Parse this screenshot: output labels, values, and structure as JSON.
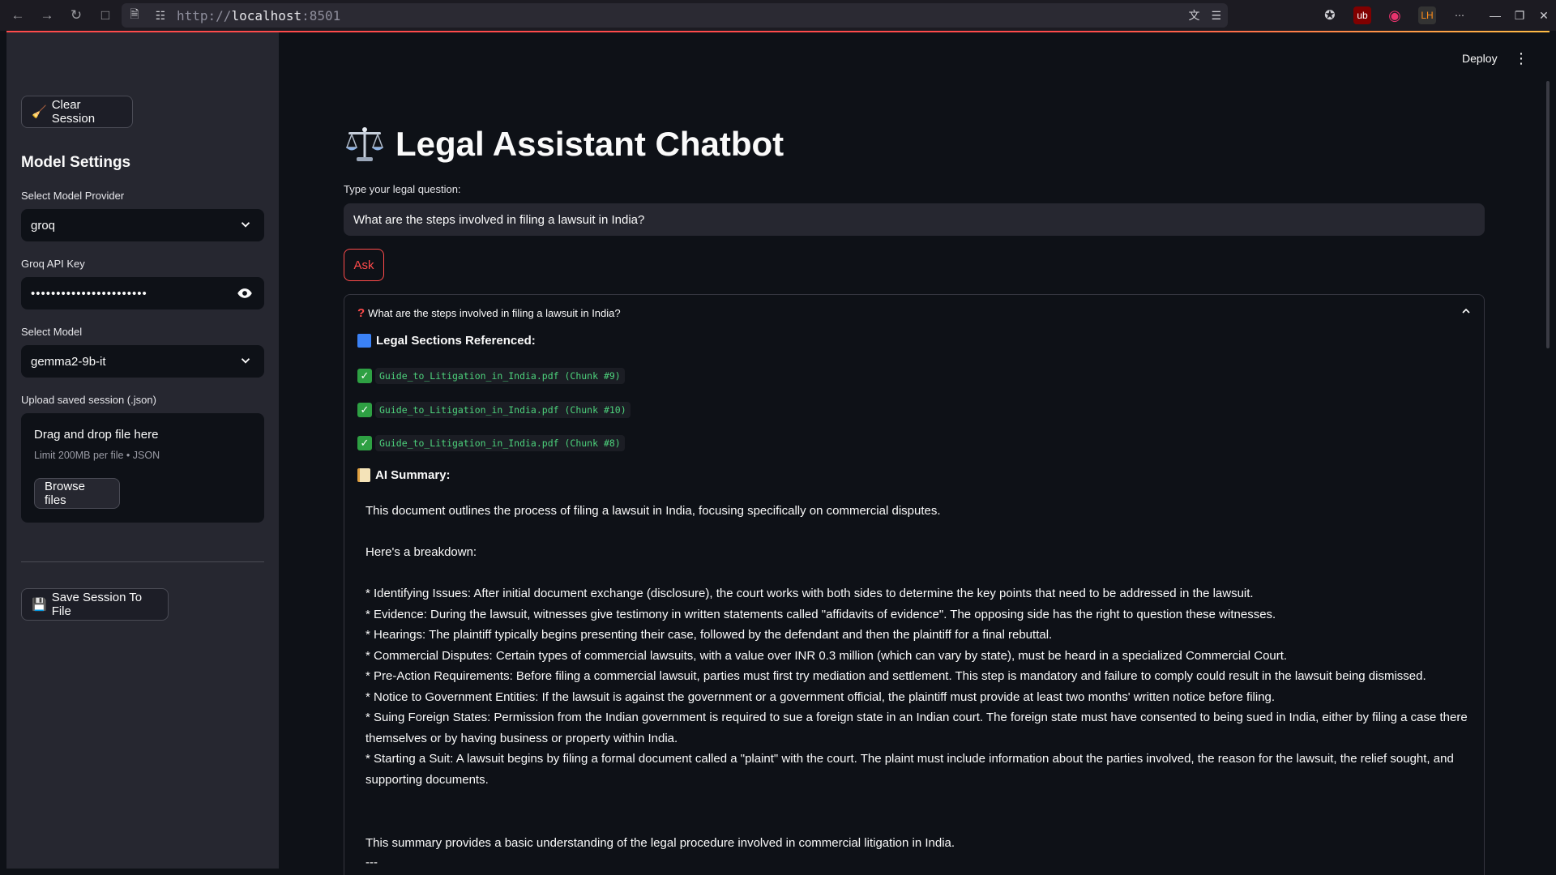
{
  "browser": {
    "url_prefix": "http://",
    "url_host": "localhost",
    "url_port": ":8501"
  },
  "sidebar": {
    "clear_session_label": "Clear Session",
    "heading": "Model Settings",
    "provider_label": "Select Model Provider",
    "provider_value": "groq",
    "api_key_label": "Groq API Key",
    "api_key_mask": "•••••••••••••••••••••••",
    "model_label": "Select Model",
    "model_value": "gemma2-9b-it",
    "upload_label": "Upload saved session (.json)",
    "dropzone_title": "Drag and drop file here",
    "dropzone_limit": "Limit 200MB per file • JSON",
    "browse_label": "Browse files",
    "save_session_label": "Save Session To File"
  },
  "header": {
    "deploy_label": "Deploy"
  },
  "main": {
    "title": "Legal Assistant Chatbot",
    "question_label": "Type your legal question:",
    "question_value": "What are the steps involved in filing a lawsuit in India?",
    "ask_label": "Ask",
    "expander_title": "What are the steps involved in filing a lawsuit in India?",
    "sections_heading": "Legal Sections Referenced:",
    "chunks": [
      "Guide_to_Litigation_in_India.pdf (Chunk #9)",
      "Guide_to_Litigation_in_India.pdf (Chunk #10)",
      "Guide_to_Litigation_in_India.pdf (Chunk #8)"
    ],
    "summary_heading": "AI Summary:",
    "summary_intro": "This document outlines the process of filing a lawsuit in India, focusing specifically on commercial disputes.",
    "summary_breakdown": "Here's a breakdown:",
    "summary_points": [
      "* Identifying Issues: After initial document exchange (disclosure), the court works with both sides to determine the key points that need to be addressed in the lawsuit.",
      "* Evidence: During the lawsuit, witnesses give testimony in written statements called \"affidavits of evidence\". The opposing side has the right to question these witnesses.",
      "* Hearings: The plaintiff typically begins presenting their case, followed by the defendant and then the plaintiff for a final rebuttal.",
      "* Commercial Disputes: Certain types of commercial lawsuits, with a value over INR 0.3 million (which can vary by state), must be heard in a specialized Commercial Court.",
      "* Pre-Action Requirements: Before filing a commercial lawsuit, parties must first try mediation and settlement. This step is mandatory and failure to comply could result in the lawsuit being dismissed.",
      "* Notice to Government Entities: If the lawsuit is against the government or a government official, the plaintiff must provide at least two months' written notice before filing.",
      "* Suing Foreign States: Permission from the Indian government is required to sue a foreign state in an Indian court. The foreign state must have consented to being sued in India, either by filing a case there themselves or by having business or property within India.",
      "* Starting a Suit: A lawsuit begins by filing a formal document called a \"plaint\" with the court. The plaint must include information about the parties involved, the reason for the lawsuit, the relief sought, and supporting documents."
    ],
    "summary_closing": "This summary provides a basic understanding of the legal procedure involved in commercial litigation in India.",
    "summary_rule": "---"
  },
  "colors": {
    "accent": "#ff4b4b",
    "sidebar_bg": "#262730",
    "main_bg": "#0e1117",
    "code_green": "#4dd27c"
  }
}
